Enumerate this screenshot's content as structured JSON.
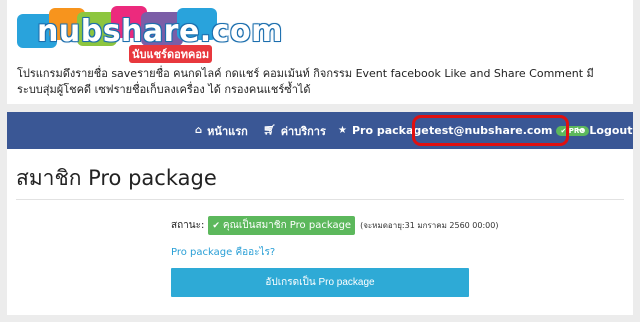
{
  "header": {
    "logo_text": "nubshare.com",
    "logo_sub": "นับแชร์ดอทคอม",
    "description": "โปรแกรมดึงรายชื่อ saveรายชื่อ คนกดไลค์ กดแชร์ คอมเม้นท์ กิจกรรม Event facebook Like and Share Comment มีระบบสุ่มผู้โชคดี เซฟรายชื่อเก็บลงเครื่อง ได้ กรองคนแชร์ซ้ำได้"
  },
  "navbar": {
    "home_label": "หน้าแรก",
    "pricing_label": "ค่าบริการ",
    "pro_label": "Pro package",
    "user_email": "test@nubshare.com",
    "user_badge": "PRO",
    "logout_label": "Logout"
  },
  "main": {
    "title": "สมาชิก Pro package",
    "status_label": "สถานะ:",
    "status_badge": "คุณเป็นสมาชิก Pro package",
    "expiry": "(จะหมดอายุ:31 มกราคม 2560 00:00)",
    "pro_link": "Pro package คืออะไร?",
    "upgrade_button": "อัปเกรดเป็น Pro package"
  },
  "colors": {
    "navbar": "#3a5795",
    "accent_green": "#5cb85c",
    "button_blue": "#2eaad6",
    "highlight_red": "#e01010"
  }
}
